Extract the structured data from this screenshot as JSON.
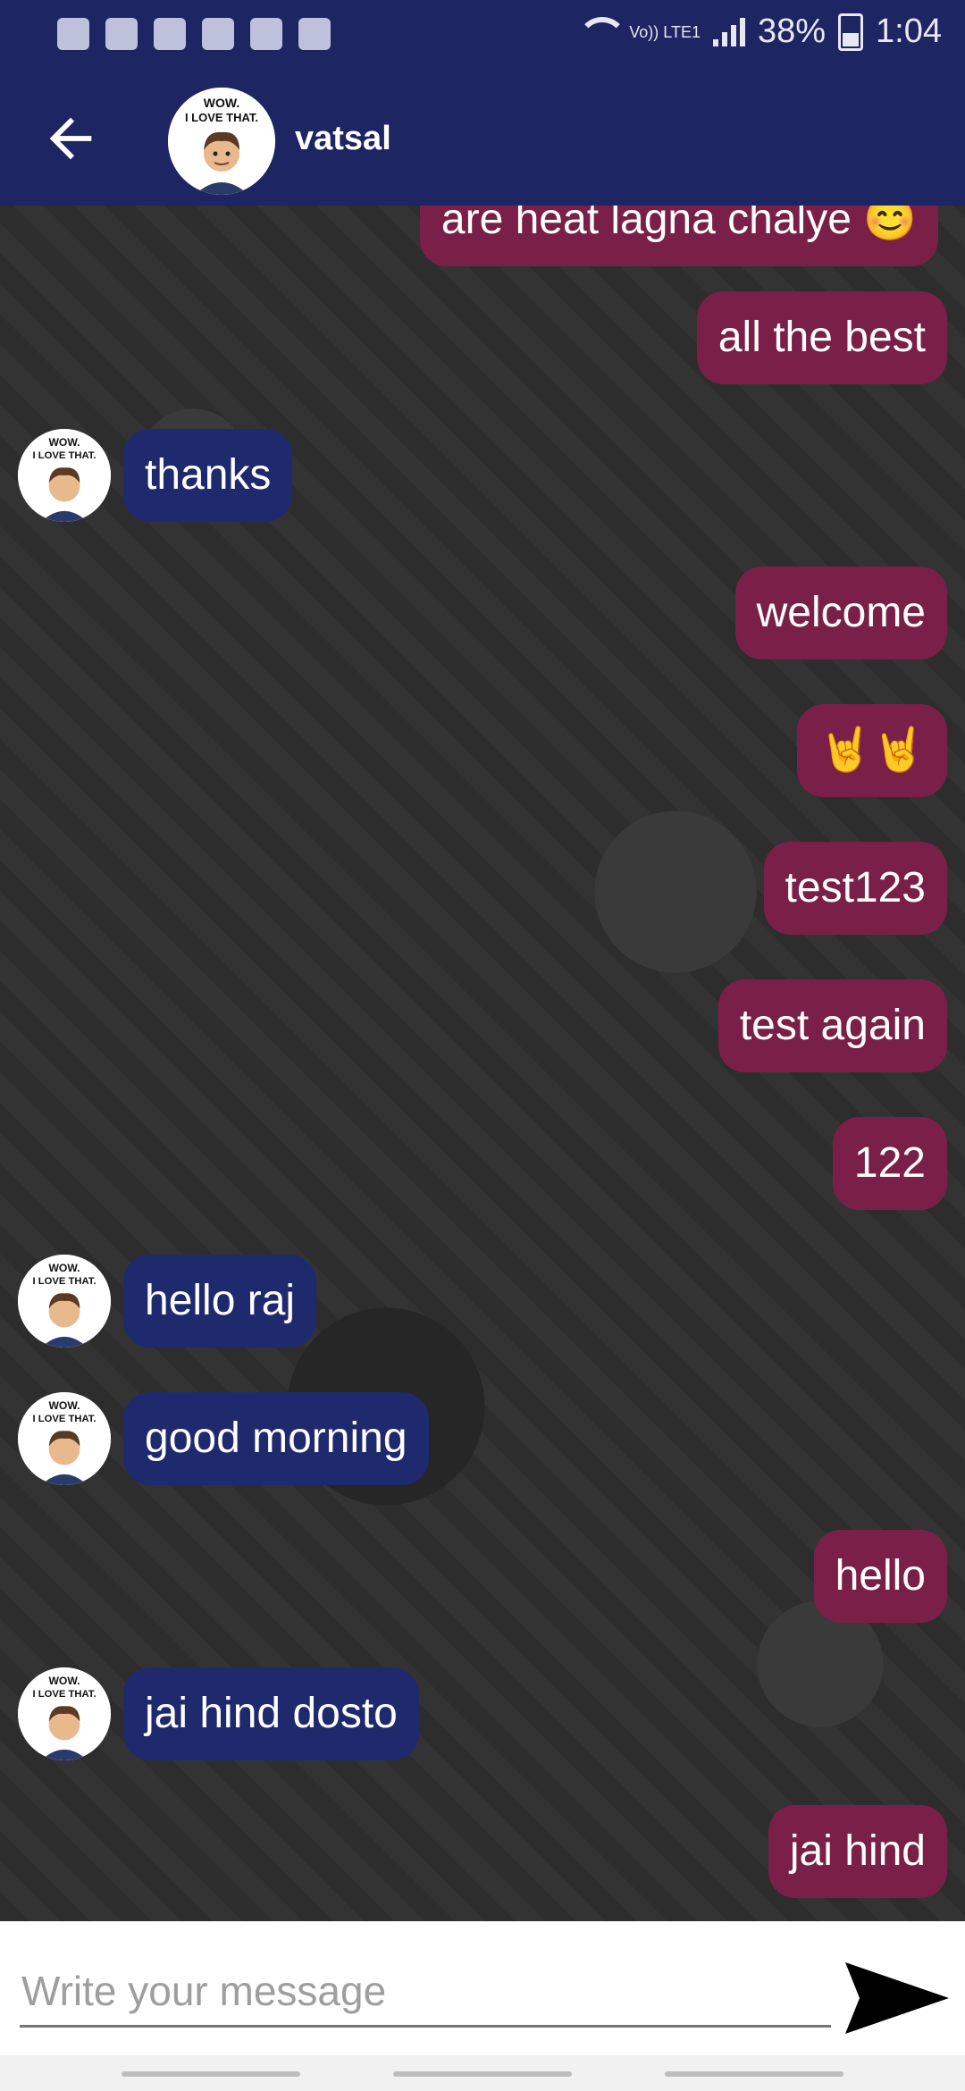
{
  "status_bar": {
    "battery": "38%",
    "time": "1:04",
    "network_label": "Vo)) LTE1",
    "notification_icons": [
      "message-icon",
      "whatsapp-icon",
      "snapchat-icon",
      "instagram-icon",
      "gallery-icon",
      "incognito-icon"
    ]
  },
  "header": {
    "contact_name": "vatsal",
    "avatar_label": "WOW. I LOVE THAT."
  },
  "colors": {
    "header_bg": "#1d2562",
    "sent_bubble": "#7a2048",
    "received_bubble": "#1f2a6e"
  },
  "messages": [
    {
      "side": "sent",
      "text": "are heat lagna chalye 😊"
    },
    {
      "side": "sent",
      "text": "all the best"
    },
    {
      "side": "received",
      "text": "thanks"
    },
    {
      "side": "sent",
      "text": "welcome"
    },
    {
      "side": "sent",
      "text": "🤘🤘"
    },
    {
      "side": "sent",
      "text": "test123"
    },
    {
      "side": "sent",
      "text": "test again"
    },
    {
      "side": "sent",
      "text": "122"
    },
    {
      "side": "received",
      "text": "hello raj"
    },
    {
      "side": "received",
      "text": "good morning"
    },
    {
      "side": "sent",
      "text": "hello"
    },
    {
      "side": "received",
      "text": "jai hind dosto"
    },
    {
      "side": "sent",
      "text": "jai hind"
    }
  ],
  "composer": {
    "placeholder": "Write your message",
    "value": ""
  }
}
